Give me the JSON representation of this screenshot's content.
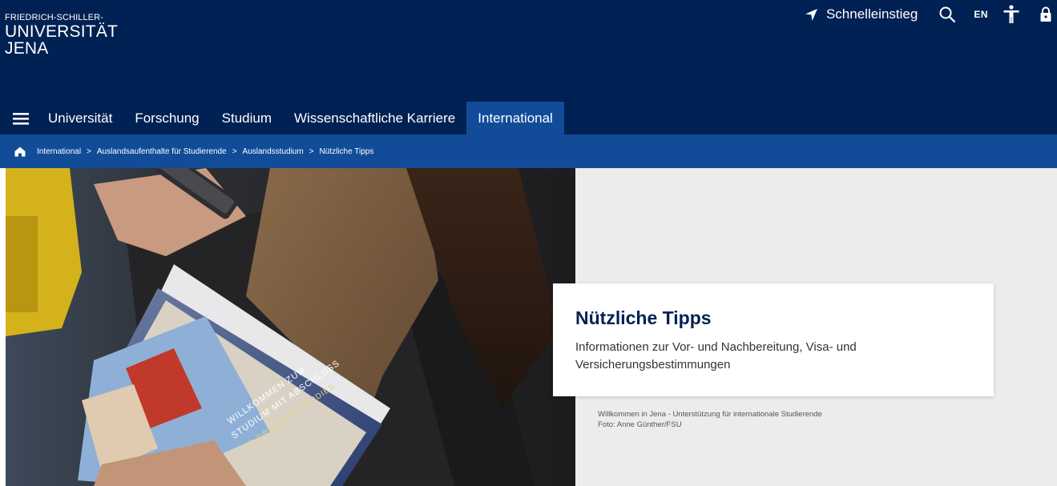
{
  "header": {
    "logo": {
      "line1": "FRIEDRICH-SCHILLER-",
      "line2": "UNIVERSITÄT",
      "line3": "JENA"
    },
    "quicklink_label": "Schnelleinstieg",
    "language_label": "EN",
    "icons": [
      "location-arrow-icon",
      "search-icon",
      "accessibility-icon",
      "lock-icon"
    ]
  },
  "nav": {
    "items": [
      {
        "label": "Universität"
      },
      {
        "label": "Forschung"
      },
      {
        "label": "Studium"
      },
      {
        "label": "Wissenschaftliche Karriere"
      },
      {
        "label": "International",
        "active": true
      }
    ]
  },
  "breadcrumb": {
    "items": [
      "International",
      "Auslandsaufenthalte für Studierende",
      "Auslandsstudium",
      "Nützliche Tipps"
    ],
    "separator": ">"
  },
  "hero": {
    "title": "Nützliche Tipps",
    "subtitle": "Informationen zur Vor- und Nachbereitung, Visa- und Versicherungsbestimmungen",
    "image_caption": "Willkommen in Jena - Unterstützung für internationale Studierende",
    "image_credit": "Foto: Anne Günther/FSU",
    "brochure_text": [
      "WILLKOMMEN ZUM",
      "STUDIUM MIT ABSCHLUSS",
      "TO GRADUATE STUDIES"
    ]
  },
  "colors": {
    "header_bg": "#002153",
    "accent_blue": "#124c99",
    "hero_bg": "#ececec"
  }
}
